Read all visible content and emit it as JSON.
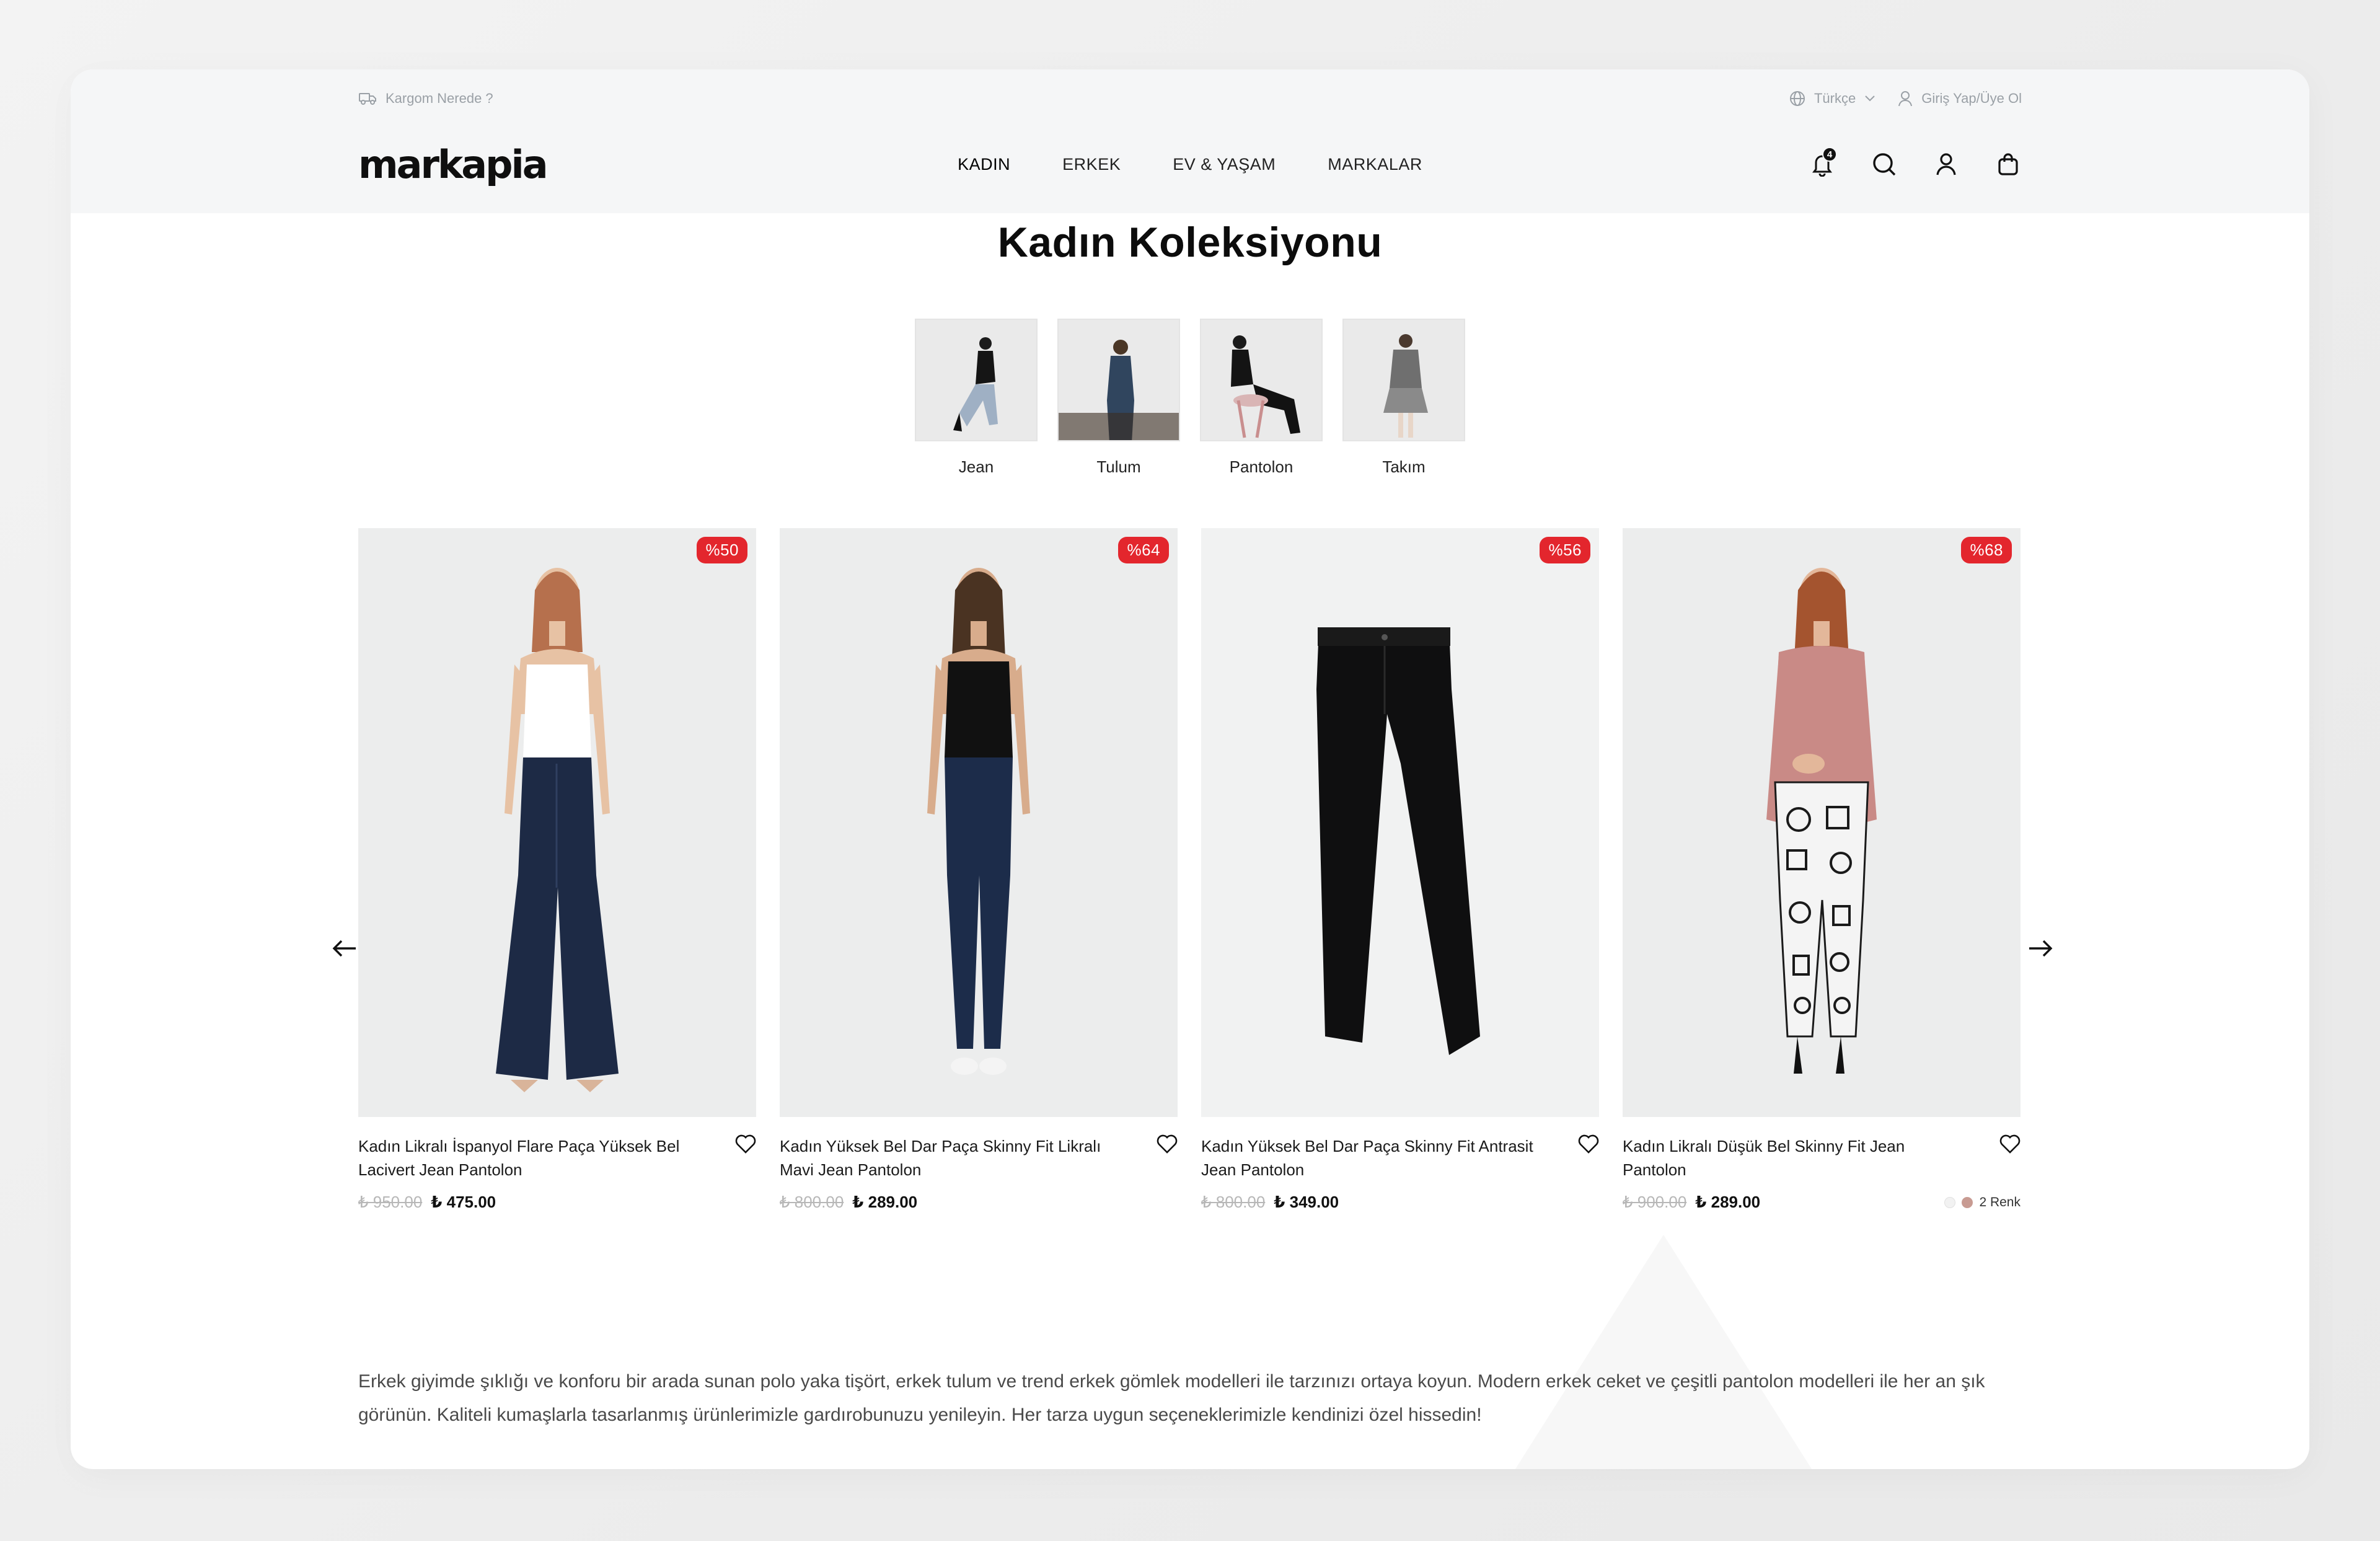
{
  "topbar": {
    "track_label": "Kargom Nerede ?",
    "language_label": "Türkçe",
    "auth_label": "Giriş Yap/Üye Ol"
  },
  "brand": {
    "logo_text": "markapia"
  },
  "nav": {
    "items": [
      "KADIN",
      "ERKEK",
      "EV & YAŞAM",
      "MARKALAR"
    ],
    "active_index": 0
  },
  "header_icons": {
    "notifications_count": "4",
    "notifications_icon": "bell-icon",
    "search_icon": "search-icon",
    "account_icon": "user-icon",
    "cart_icon": "bag-icon"
  },
  "page": {
    "title": "Kadın Koleksiyonu"
  },
  "categories": [
    {
      "label": "Jean"
    },
    {
      "label": "Tulum"
    },
    {
      "label": "Pantolon"
    },
    {
      "label": "Takım"
    }
  ],
  "products": [
    {
      "discount": "%50",
      "name": "Kadın Likralı İspanyol Flare Paça Yüksek Bel Lacivert Jean Pantolon",
      "old_price": "₺ 950.00",
      "new_price": "₺ 475.00",
      "colors_label": ""
    },
    {
      "discount": "%64",
      "name": "Kadın Yüksek Bel Dar Paça Skinny Fit Likralı Mavi Jean Pantolon",
      "old_price": "₺ 800.00",
      "new_price": "₺ 289.00",
      "colors_label": ""
    },
    {
      "discount": "%56",
      "name": "Kadın Yüksek Bel Dar Paça Skinny Fit Antrasit Jean Pantolon",
      "old_price": "₺ 800.00",
      "new_price": "₺ 349.00",
      "colors_label": ""
    },
    {
      "discount": "%68",
      "name": "Kadın Likralı Düşük Bel Skinny Fit Jean Pantolon",
      "old_price": "₺ 900.00",
      "new_price": "₺ 289.00",
      "colors_label": "2 Renk"
    }
  ],
  "swatch_colors": [
    "#f2f2f2",
    "#c89b92"
  ],
  "description": "Erkek giyimde şıklığı ve konforu bir arada sunan polo yaka tişört, erkek tulum ve trend erkek gömlek modelleri ile tarzınızı ortaya koyun. Modern erkek ceket ve çeşitli pantolon modelleri ile her an şık görünün. Kaliteli kumaşlarla tasarlanmış ürünlerimizle gardırobunuzu yenileyin. Her tarza uygun seçeneklerimizle kendinizi özel hissedin!"
}
